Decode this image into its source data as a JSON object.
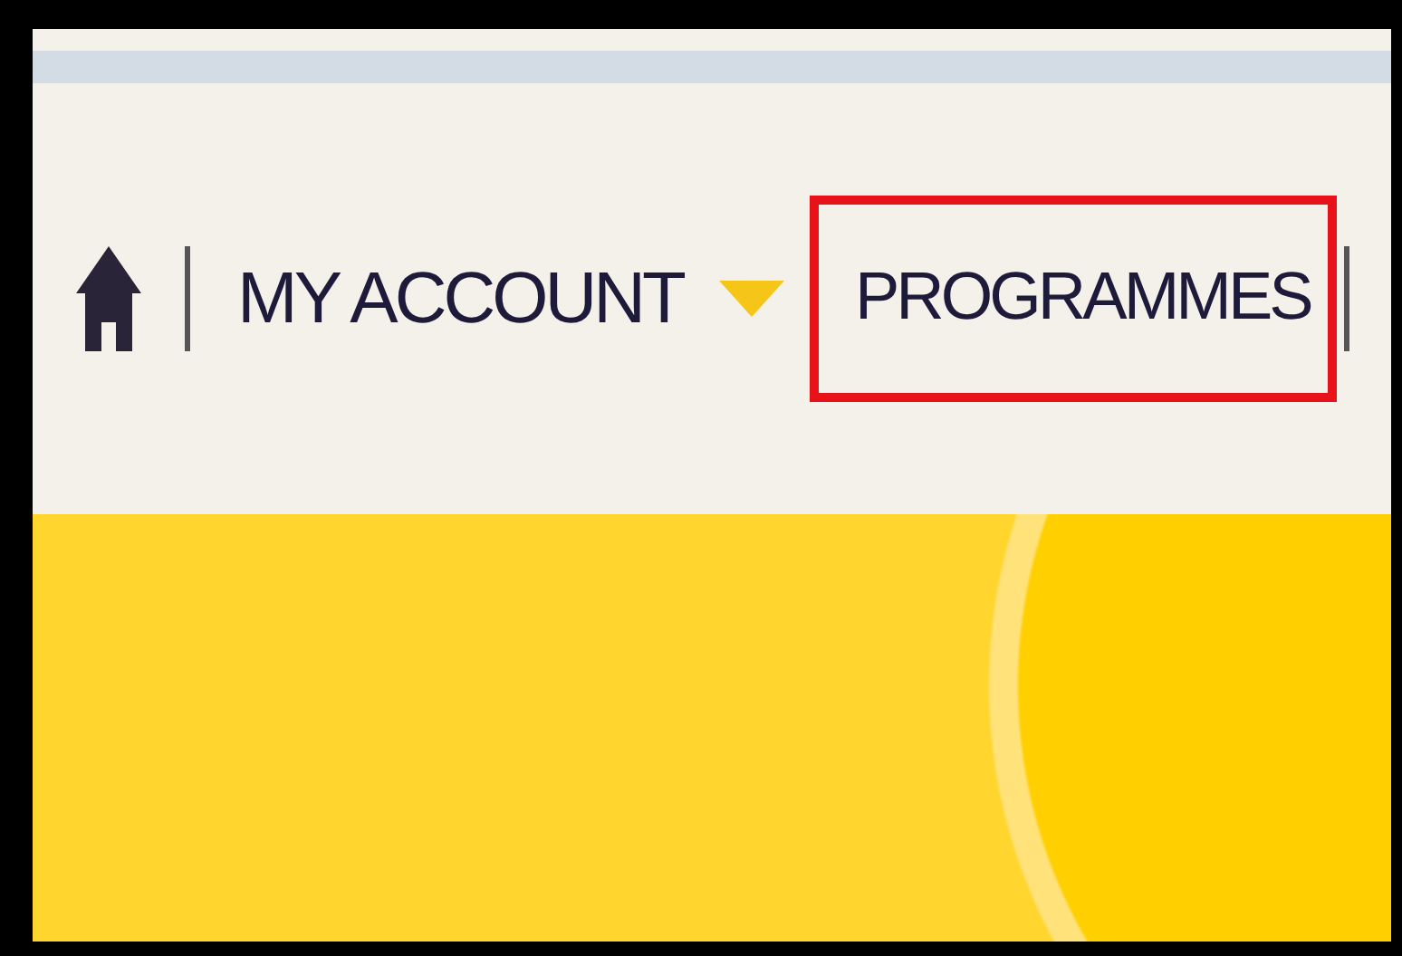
{
  "nav": {
    "items": [
      {
        "label": "MY ACCOUNT",
        "dropdown": true,
        "highlighted": false
      },
      {
        "label": "PROGRAMMES",
        "dropdown": false,
        "highlighted": true
      }
    ]
  }
}
